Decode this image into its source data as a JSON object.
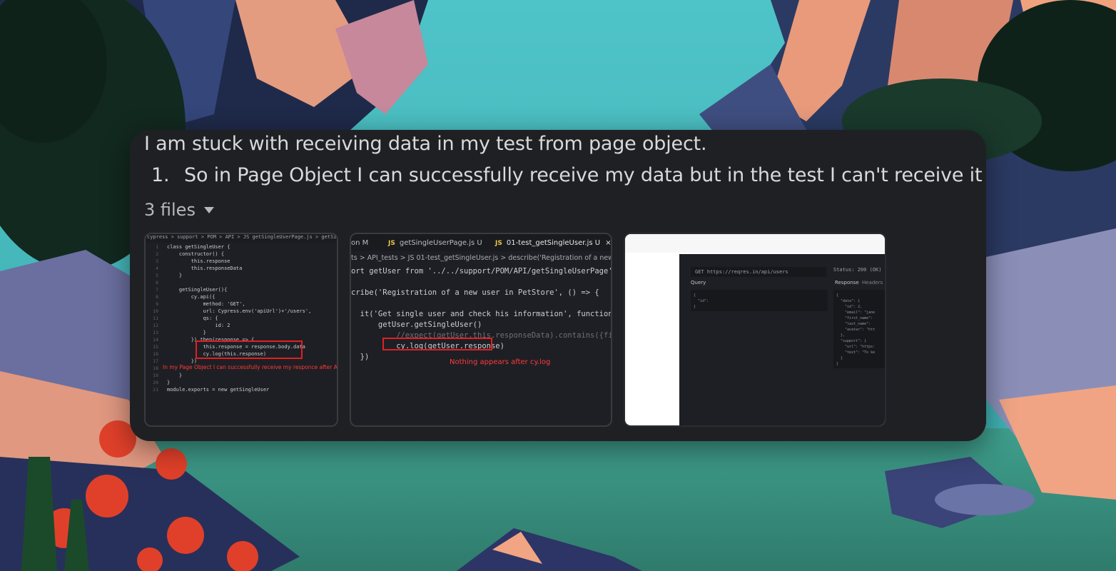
{
  "message": {
    "line1": "I am stuck with receiving data in my test from page object.",
    "list_number": "1.",
    "list_item": "So in Page Object I can successfully receive my data but in the test I can't receive it"
  },
  "files": {
    "toggle_label": "3 files",
    "thumb1": {
      "breadcrumb": "cypress > support > POM > API > JS getSingleUserPage.js > getSingleUser > ge",
      "code": [
        {
          "n": "1",
          "t": "class getSingleUser {"
        },
        {
          "n": "2",
          "t": "    constructor() {"
        },
        {
          "n": "3",
          "t": "        this.response"
        },
        {
          "n": "4",
          "t": "        this.responseData"
        },
        {
          "n": "5",
          "t": "    }"
        },
        {
          "n": "6",
          "t": ""
        },
        {
          "n": "7",
          "t": "    getSingleUser(){"
        },
        {
          "n": "8",
          "t": "        cy.api({"
        },
        {
          "n": "9",
          "t": "            method: 'GET',"
        },
        {
          "n": "10",
          "t": "            url: Cypress.env('apiUrl')+'/users',"
        },
        {
          "n": "11",
          "t": "            qs: {"
        },
        {
          "n": "12",
          "t": "                id: 2"
        },
        {
          "n": "13",
          "t": "            }"
        },
        {
          "n": "14",
          "t": "        }).then(response => {"
        },
        {
          "n": "15",
          "t": "            this.response = response.body.data"
        },
        {
          "n": "16",
          "t": "            cy.log(this.response)"
        },
        {
          "n": "17",
          "t": "        })"
        },
        {
          "n": "18",
          "t": ""
        },
        {
          "n": "19",
          "t": "    }"
        },
        {
          "n": "20",
          "t": "}"
        },
        {
          "n": "21",
          "t": "module.exports = new getSingleUser"
        }
      ],
      "annotation": "In my Page Object I can successfully receive my responce after API call"
    },
    "thumb2": {
      "tab_partial": "on M",
      "tab1_badge": "JS",
      "tab1": "getSingleUserPage.js U",
      "tab2_badge": "JS",
      "tab2": "01-test_getSingleUser.js U",
      "tab_close": "×",
      "breadcrumb": "ts > API_tests > JS 01-test_getSingleUser.js > describe('Registration of a new us",
      "code": [
        "ort getUser from '../../support/POM/API/getSingleUserPage'",
        "",
        "cribe('Registration of a new user in PetStore', () => {",
        "",
        "  it('Get single user and check his information', function() {",
        "      getUser.getSingleUser()",
        "          //expect(getUser.this.responseData).contains({first_n",
        "          cy.log(getUser.response)",
        "  })"
      ],
      "annotation": "Nothing appears after cy.log"
    },
    "thumb3": {
      "url": "GET https://reqres.in/api/users",
      "status": "Status: 200 (OK)  Dura",
      "query_label": "Query",
      "response_label": "Response",
      "headers_label": "Headers",
      "query_body": "{ \n  \"id\": \n}",
      "response_body": "{\n  \"data\": {\n    \"id\": 2,\n    \"email\": \"jane\n    \"first_name\":\n    \"last_name\":\n    \"avatar\": \"htt\n  },\n  \"support\": {\n    \"url\": \"https:\n    \"text\": \"To ke\n  }\n}"
    }
  }
}
